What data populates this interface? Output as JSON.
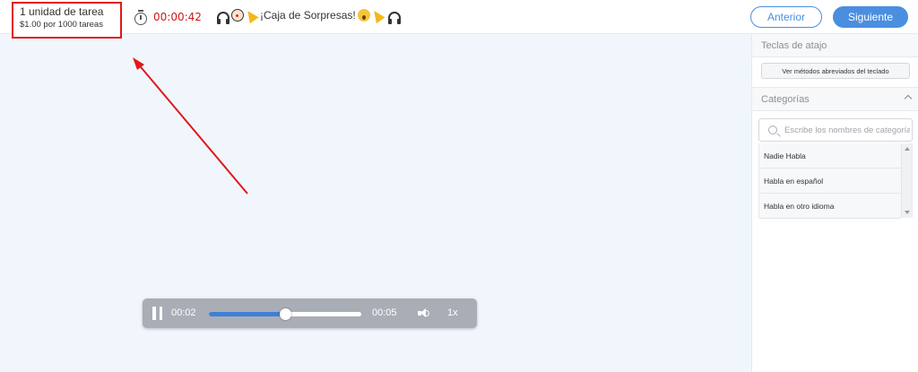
{
  "task": {
    "units": "1 unidad de tarea",
    "price": "$1.00 por 1000 tareas"
  },
  "timer": {
    "value": "00:00:42",
    "icon": "stopwatch-icon"
  },
  "banner": {
    "text": "¡Caja de Sorpresas!",
    "icons_left": [
      "headphones-icon",
      "clown-icon",
      "party-popper-icon"
    ],
    "icons_right": [
      "surprised-face-icon",
      "party-popper-icon",
      "headphones-icon"
    ]
  },
  "nav": {
    "prev_label": "Anterior",
    "next_label": "Siguiente"
  },
  "shortcuts": {
    "header": "Teclas de atajo",
    "button_label": "Ver métodos abreviados del teclado"
  },
  "categories": {
    "header": "Categorías",
    "search_placeholder": "Escribe los nombres de categoría",
    "items": [
      {
        "label": "Nadie Habla"
      },
      {
        "label": "Habla en español"
      },
      {
        "label": "Habla en otro idioma"
      }
    ]
  },
  "player": {
    "current_time": "00:02",
    "duration": "00:05",
    "speed": "1x",
    "progress": 0.5
  },
  "colors": {
    "accent": "#4a8ee0",
    "timer": "#d0161b",
    "annotation": "#e0191b"
  }
}
